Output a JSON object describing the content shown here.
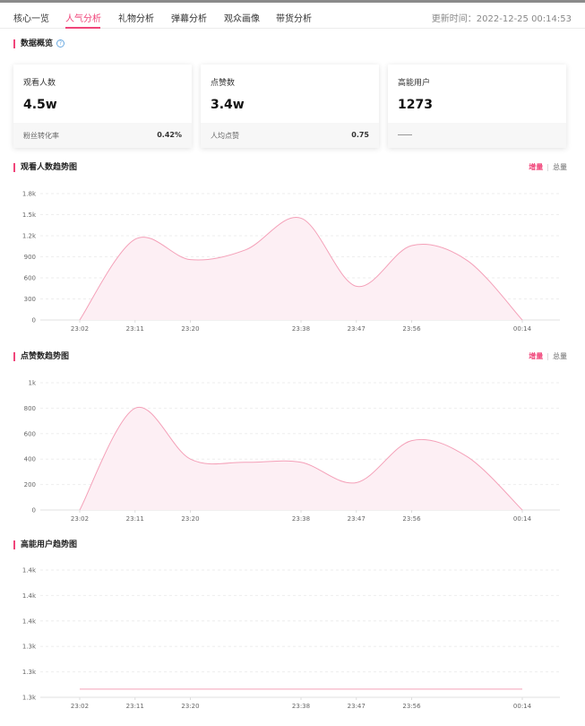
{
  "tabs": [
    {
      "label": "核心一览",
      "active": false
    },
    {
      "label": "人气分析",
      "active": true
    },
    {
      "label": "礼物分析",
      "active": false
    },
    {
      "label": "弹幕分析",
      "active": false
    },
    {
      "label": "观众画像",
      "active": false
    },
    {
      "label": "带货分析",
      "active": false
    }
  ],
  "update_time": "更新时间：2022-12-25 00:14:53",
  "overview": {
    "title": "数据概览",
    "help_icon": "question-circle-icon",
    "cards": [
      {
        "label": "观看人数",
        "value": "4.5w",
        "foot_label": "粉丝转化率",
        "foot_value": "0.42%"
      },
      {
        "label": "点赞数",
        "value": "3.4w",
        "foot_label": "人均点赞",
        "foot_value": "0.75"
      },
      {
        "label": "高能用户",
        "value": "1273",
        "foot_label": "",
        "foot_value": ""
      }
    ]
  },
  "toggle": {
    "increment": "增量",
    "total": "总量"
  },
  "colors": {
    "accent": "#f0457a",
    "line": "#f4a0b8",
    "fill": "#fdeff4"
  },
  "chart_data": [
    {
      "type": "area",
      "title": "观看人数趋势图",
      "categories": [
        "23:02",
        "23:11",
        "23:20",
        "23:38",
        "23:47",
        "23:56",
        "00:14"
      ],
      "y_ticks": [
        "0",
        "300",
        "600",
        "900",
        "1.2k",
        "1.5k",
        "1.8k"
      ],
      "ylim": [
        0,
        1800
      ],
      "x": [
        "23:02",
        "23:11",
        "23:20",
        "23:29",
        "23:38",
        "23:47",
        "23:56",
        "00:05",
        "00:14"
      ],
      "values": [
        0,
        1150,
        860,
        1000,
        1450,
        480,
        1060,
        850,
        0
      ],
      "grid": true
    },
    {
      "type": "area",
      "title": "点赞数趋势图",
      "categories": [
        "23:02",
        "23:11",
        "23:20",
        "23:38",
        "23:47",
        "23:56",
        "00:14"
      ],
      "y_ticks": [
        "0",
        "200",
        "400",
        "600",
        "800",
        "1k"
      ],
      "ylim": [
        0,
        1000
      ],
      "x": [
        "23:02",
        "23:11",
        "23:20",
        "23:29",
        "23:38",
        "23:47",
        "23:56",
        "00:05",
        "00:14"
      ],
      "values": [
        0,
        800,
        400,
        375,
        375,
        215,
        545,
        420,
        0
      ],
      "grid": true
    },
    {
      "type": "line",
      "title": "高能用户趋势图",
      "categories": [
        "23:02",
        "23:11",
        "23:20",
        "23:38",
        "23:47",
        "23:56",
        "00:14"
      ],
      "y_ticks": [
        "1.3k",
        "1.3k",
        "1.3k",
        "1.4k",
        "1.4k",
        "1.4k"
      ],
      "ylim": [
        1265,
        1390
      ],
      "x": [
        "23:02",
        "00:14"
      ],
      "values": [
        1273,
        1273
      ],
      "grid": true
    }
  ]
}
